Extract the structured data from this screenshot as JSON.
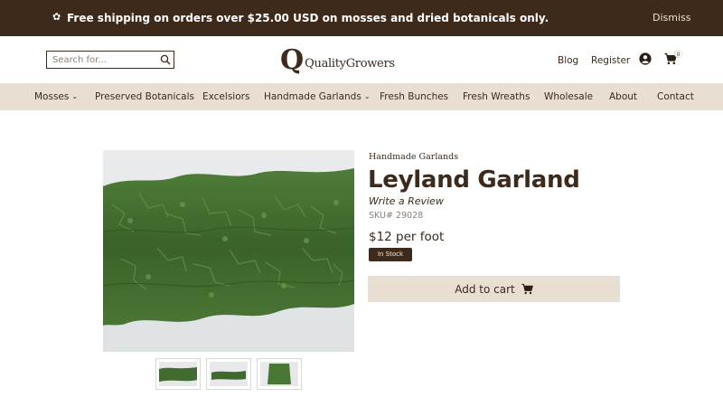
{
  "announcement": {
    "message": "Free shipping on orders over $25.00 USD on mosses and dried botanicals only.",
    "dismiss": "Dismiss"
  },
  "header": {
    "search_placeholder": "Search for...",
    "logo_mark": "Q",
    "logo_text": "QualityGrowers",
    "blog": "Blog",
    "register": "Register",
    "cart_count": "0"
  },
  "categories": [
    {
      "label": "Mosses",
      "dropdown": true
    },
    {
      "label": "Preserved Botanicals",
      "dropdown": false
    },
    {
      "label": "Excelsiors",
      "dropdown": false
    },
    {
      "label": "Handmade Garlands",
      "dropdown": true
    },
    {
      "label": "Fresh Bunches",
      "dropdown": false
    },
    {
      "label": "Fresh Wreaths",
      "dropdown": false
    },
    {
      "label": "Wholesale",
      "dropdown": false
    },
    {
      "label": "About",
      "dropdown": false
    },
    {
      "label": "Contact",
      "dropdown": false
    }
  ],
  "product": {
    "breadcrumb": "Handmade Garlands",
    "title": "Leyland Garland",
    "review_link": "Write a Review",
    "sku": "SKU# 29028",
    "price": "$12 per foot",
    "stock": "In Stock",
    "add_to_cart": "Add to cart"
  },
  "colors": {
    "brand_dark": "#3e2a1b",
    "nav_bg": "#e8dfd2",
    "foliage": "#3f6b2e"
  },
  "icons": {
    "announcement": "leaf-icon",
    "search": "search-icon",
    "account": "user-icon",
    "cart": "cart-icon"
  }
}
